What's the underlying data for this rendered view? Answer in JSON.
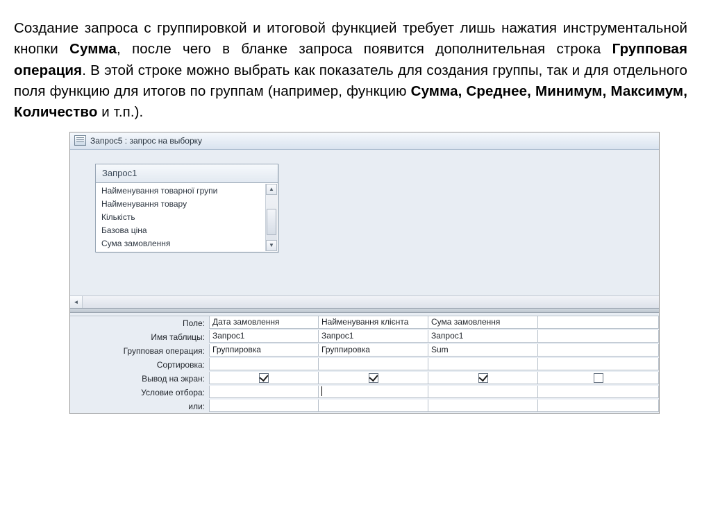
{
  "paragraph": {
    "p1a": "Создание запроса с группировкой и итоговой функцией требует лишь нажатия инструментальной кнопки ",
    "p1b": "Сумма",
    "p1c": ", после чего в бланке запроса появится дополнительная строка ",
    "p1d": "Групповая операция",
    "p1e": ". В этой строке можно выбрать как показатель для создания группы, так и для отдельного поля функцию для итогов по группам (например, функцию ",
    "p1f": "Сумма, Среднее, Минимум, Максимум, Количество",
    "p1g": " и т.п.)."
  },
  "window": {
    "title": "Запрос5 : запрос на выборку"
  },
  "sourceTable": {
    "name": "Запрос1",
    "fields": [
      "Найменування товарної групи",
      "Найменування товару",
      "Кількість",
      "Базова ціна",
      "Сума замовлення"
    ]
  },
  "design": {
    "labels": {
      "field": "Поле:",
      "table": "Имя таблицы:",
      "total": "Групповая операция:",
      "sort": "Сортировка:",
      "show": "Вывод на экран:",
      "criteria": "Условие отбора:",
      "or": "или:"
    },
    "cols": [
      {
        "field": "Дата замовлення",
        "table": "Запрос1",
        "total": "Группировка",
        "sort": "",
        "show": true,
        "criteria": "",
        "or": ""
      },
      {
        "field": "Найменування клієнта",
        "table": "Запрос1",
        "total": "Группировка",
        "sort": "",
        "show": true,
        "criteria": "",
        "or": ""
      },
      {
        "field": "Сума замовлення",
        "table": "Запрос1",
        "total": "Sum",
        "sort": "",
        "show": true,
        "criteria": "",
        "or": ""
      }
    ]
  }
}
